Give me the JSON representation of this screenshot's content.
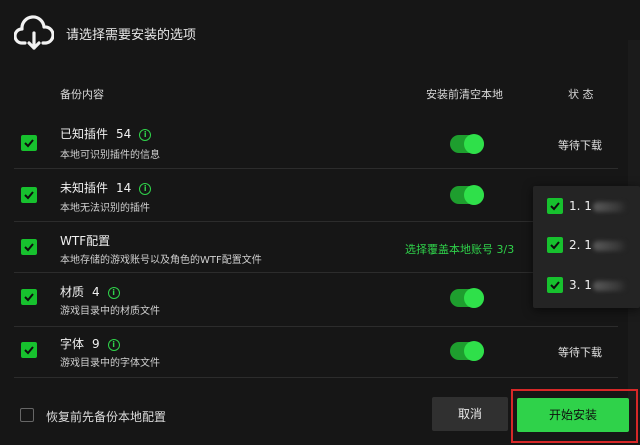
{
  "header": {
    "title": "请选择需要安装的选项",
    "icon": "cloud-download-icon"
  },
  "columns": {
    "content": "备份内容",
    "clear_before": "安装前清空本地",
    "status": "状 态"
  },
  "rows": [
    {
      "name": "已知插件",
      "count": "54",
      "has_info": true,
      "desc": "本地可识别插件的信息",
      "checked": true,
      "toggle_on": true,
      "status": "等待下载"
    },
    {
      "name": "未知插件",
      "count": "14",
      "has_info": true,
      "desc": "本地无法识别的插件",
      "checked": true,
      "toggle_on": true,
      "status": ""
    },
    {
      "name": "WTF配置",
      "count": "",
      "has_info": false,
      "desc": "本地存储的游戏账号以及角色的WTF配置文件",
      "checked": true,
      "link": "选择覆盖本地账号 3/3"
    },
    {
      "name": "材质",
      "count": "4",
      "has_info": true,
      "desc": "游戏目录中的材质文件",
      "checked": true,
      "toggle_on": true,
      "status": ""
    },
    {
      "name": "字体",
      "count": "9",
      "has_info": true,
      "desc": "游戏目录中的字体文件",
      "checked": true,
      "toggle_on": true,
      "status": "等待下载"
    }
  ],
  "account_popup": {
    "items": [
      {
        "label": "1. 1",
        "checked": true
      },
      {
        "label": "2. 1",
        "checked": true
      },
      {
        "label": "3. 1",
        "checked": true
      }
    ]
  },
  "footer": {
    "backup_label": "恢复前先备份本地配置",
    "cancel_label": "取消",
    "start_label": "开始安装"
  },
  "colors": {
    "accent": "#2fd24a",
    "bg": "#161616",
    "highlight": "#d62828"
  }
}
